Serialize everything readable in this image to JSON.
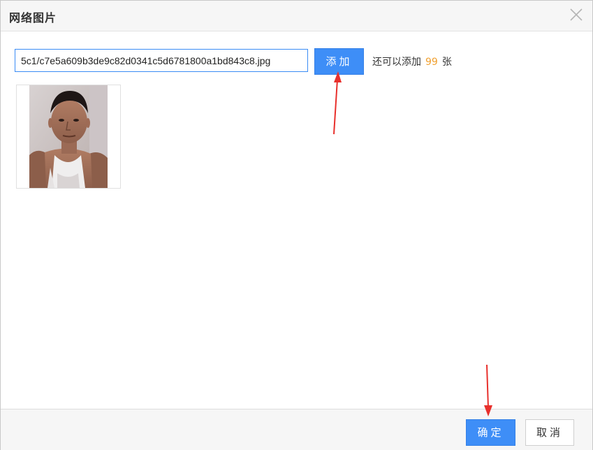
{
  "dialog": {
    "title": "网络图片"
  },
  "url_input": {
    "value": "5c1/c7e5a609b3de9c82d0341c5d6781800a1bd843c8.jpg"
  },
  "add_button": {
    "label": "添加"
  },
  "remaining": {
    "prefix": "还可以添加",
    "count": "99",
    "suffix": "张"
  },
  "footer": {
    "confirm_label": "确定",
    "cancel_label": "取消"
  },
  "colors": {
    "primary": "#3e8ef7",
    "count_accent": "#f0a030",
    "annotation_arrow": "#e8302c"
  }
}
